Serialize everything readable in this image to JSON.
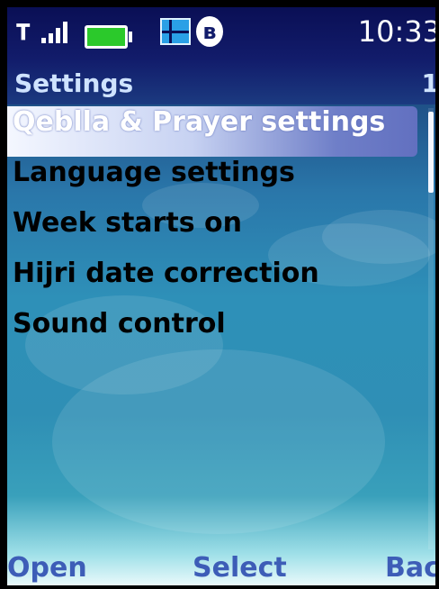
{
  "status_bar": {
    "signal_icon": "signal-strength-icon",
    "battery_icon": "battery-icon",
    "network_icon": "network-icon",
    "bluetooth_icon": "bluetooth-icon",
    "bluetooth_glyph": "ʙ",
    "time": "10:33"
  },
  "header": {
    "title": "Settings",
    "page_indicator": "1"
  },
  "menu": {
    "items": [
      {
        "label": "Qeblla & Prayer settings",
        "selected": true
      },
      {
        "label": "Language settings",
        "selected": false
      },
      {
        "label": "Week starts on",
        "selected": false
      },
      {
        "label": "Hijri date correction",
        "selected": false
      },
      {
        "label": "Sound control",
        "selected": false
      }
    ]
  },
  "softkeys": {
    "left": "Open",
    "middle": "Select",
    "right": "Back"
  },
  "colors": {
    "status_bar": "#0a0f55",
    "selection": "#6270c0",
    "softkey_text": "#3d5db7",
    "battery": "#2bc92b"
  }
}
